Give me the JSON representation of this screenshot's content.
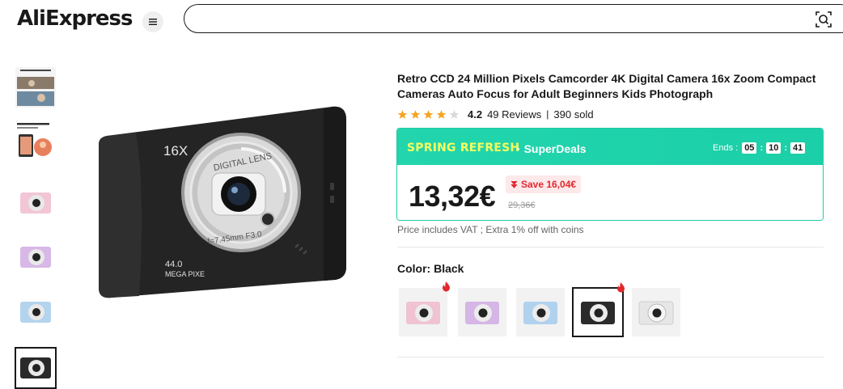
{
  "header": {
    "logo": "AliExpress",
    "search_placeholder": ""
  },
  "thumbnails": [
    {
      "label": "thumb-banner-1",
      "caption": "Nose audio and clearer"
    },
    {
      "label": "thumb-banner-2",
      "caption": "Multiple Beauty Filters"
    },
    {
      "label": "thumb-pink",
      "color": "#f2c6d6"
    },
    {
      "label": "thumb-purple",
      "color": "#d7b8e6"
    },
    {
      "label": "thumb-blue",
      "color": "#b4d4ee"
    },
    {
      "label": "thumb-black",
      "color": "#2a2a2a",
      "selected": true
    }
  ],
  "main_image": {
    "zoom_text": "16X",
    "lens_ring_text": "DIGITAL LENS",
    "lens_spec": "f=7.45mm F3.0",
    "mp_value": "44.0",
    "mp_label": "MEGA PIXE"
  },
  "product": {
    "title": "Retro CCD 24 Million Pixels Camcorder 4K Digital Camera 16x Zoom Compact Cameras Auto Focus for Adult Beginners Kids Photograph",
    "rating": "4.2",
    "reviews": "49 Reviews",
    "separator": "|",
    "sold": "390 sold",
    "stars_filled": 4
  },
  "deal": {
    "campaign": "SPRING REFRESH",
    "dot": "·",
    "program": "SuperDeals",
    "ends_label": "Ends :",
    "hours": "05",
    "minutes": "10",
    "seconds": "41",
    "colon": ":",
    "price": "13,32€",
    "save": "Save 16,04€",
    "old_price": "29,36€",
    "accent": "#1fd3ac",
    "campaign_color": "#f7ff5c",
    "save_color": "#e0282e"
  },
  "vat_note": "Price includes VAT ; Extra 1% off with coins",
  "color": {
    "label": "Color: Black",
    "swatches": [
      {
        "name": "Pink",
        "body": "#f0c3d2",
        "hot": true
      },
      {
        "name": "Purple",
        "body": "#d5b6e6",
        "hot": false
      },
      {
        "name": "Blue",
        "body": "#b1d2ee",
        "hot": false
      },
      {
        "name": "Black",
        "body": "#2b2b2b",
        "hot": true,
        "selected": true
      },
      {
        "name": "White",
        "body": "#ececec",
        "hot": false
      }
    ]
  }
}
